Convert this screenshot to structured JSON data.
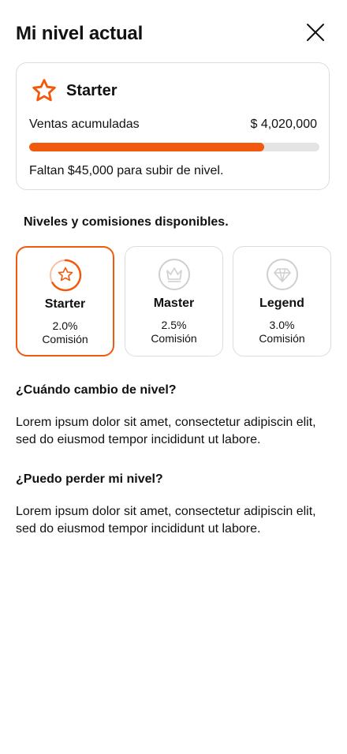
{
  "header": {
    "title": "Mi nivel actual",
    "close_icon": "close-icon"
  },
  "current_level": {
    "name": "Starter",
    "icon": "star-icon",
    "sales_label": "Ventas acumuladas",
    "sales_value": "$ 4,020,000",
    "progress_percent": 81,
    "remaining_text": "Faltan $45,000 para subir de nivel."
  },
  "levels_section": {
    "title": "Niveles y comisiones disponibles.",
    "levels": [
      {
        "name": "Starter",
        "rate": "2.0%",
        "label": "Comisión",
        "icon": "star-icon",
        "active": true
      },
      {
        "name": "Master",
        "rate": "2.5%",
        "label": "Comisión",
        "icon": "crown-icon",
        "active": false
      },
      {
        "name": "Legend",
        "rate": "3.0%",
        "label": "Comisión",
        "icon": "diamond-icon",
        "active": false
      }
    ]
  },
  "faq": [
    {
      "question": "¿Cuándo cambio de nivel?",
      "answer": "Lorem ipsum dolor sit amet, consectetur adipiscin elit, sed do eiusmod tempor incididunt ut labore."
    },
    {
      "question": "¿Puedo perder mi nivel?",
      "answer": "Lorem ipsum dolor sit amet, consectetur adipiscin elit, sed do eiusmod tempor incididunt ut labore."
    }
  ],
  "colors": {
    "accent": "#f15a0c",
    "track": "#e4e4e4",
    "border": "#dcdcdc",
    "muted_icon": "#cfcfcf"
  }
}
